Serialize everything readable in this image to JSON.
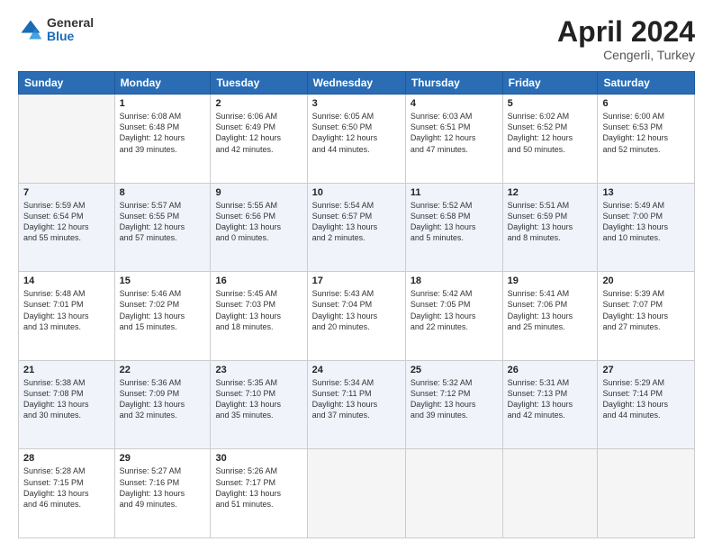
{
  "logo": {
    "general": "General",
    "blue": "Blue"
  },
  "title": {
    "month": "April 2024",
    "location": "Cengerli, Turkey"
  },
  "headers": [
    "Sunday",
    "Monday",
    "Tuesday",
    "Wednesday",
    "Thursday",
    "Friday",
    "Saturday"
  ],
  "weeks": [
    [
      {
        "date": "",
        "info": ""
      },
      {
        "date": "1",
        "info": "Sunrise: 6:08 AM\nSunset: 6:48 PM\nDaylight: 12 hours\nand 39 minutes."
      },
      {
        "date": "2",
        "info": "Sunrise: 6:06 AM\nSunset: 6:49 PM\nDaylight: 12 hours\nand 42 minutes."
      },
      {
        "date": "3",
        "info": "Sunrise: 6:05 AM\nSunset: 6:50 PM\nDaylight: 12 hours\nand 44 minutes."
      },
      {
        "date": "4",
        "info": "Sunrise: 6:03 AM\nSunset: 6:51 PM\nDaylight: 12 hours\nand 47 minutes."
      },
      {
        "date": "5",
        "info": "Sunrise: 6:02 AM\nSunset: 6:52 PM\nDaylight: 12 hours\nand 50 minutes."
      },
      {
        "date": "6",
        "info": "Sunrise: 6:00 AM\nSunset: 6:53 PM\nDaylight: 12 hours\nand 52 minutes."
      }
    ],
    [
      {
        "date": "7",
        "info": "Sunrise: 5:59 AM\nSunset: 6:54 PM\nDaylight: 12 hours\nand 55 minutes."
      },
      {
        "date": "8",
        "info": "Sunrise: 5:57 AM\nSunset: 6:55 PM\nDaylight: 12 hours\nand 57 minutes."
      },
      {
        "date": "9",
        "info": "Sunrise: 5:55 AM\nSunset: 6:56 PM\nDaylight: 13 hours\nand 0 minutes."
      },
      {
        "date": "10",
        "info": "Sunrise: 5:54 AM\nSunset: 6:57 PM\nDaylight: 13 hours\nand 2 minutes."
      },
      {
        "date": "11",
        "info": "Sunrise: 5:52 AM\nSunset: 6:58 PM\nDaylight: 13 hours\nand 5 minutes."
      },
      {
        "date": "12",
        "info": "Sunrise: 5:51 AM\nSunset: 6:59 PM\nDaylight: 13 hours\nand 8 minutes."
      },
      {
        "date": "13",
        "info": "Sunrise: 5:49 AM\nSunset: 7:00 PM\nDaylight: 13 hours\nand 10 minutes."
      }
    ],
    [
      {
        "date": "14",
        "info": "Sunrise: 5:48 AM\nSunset: 7:01 PM\nDaylight: 13 hours\nand 13 minutes."
      },
      {
        "date": "15",
        "info": "Sunrise: 5:46 AM\nSunset: 7:02 PM\nDaylight: 13 hours\nand 15 minutes."
      },
      {
        "date": "16",
        "info": "Sunrise: 5:45 AM\nSunset: 7:03 PM\nDaylight: 13 hours\nand 18 minutes."
      },
      {
        "date": "17",
        "info": "Sunrise: 5:43 AM\nSunset: 7:04 PM\nDaylight: 13 hours\nand 20 minutes."
      },
      {
        "date": "18",
        "info": "Sunrise: 5:42 AM\nSunset: 7:05 PM\nDaylight: 13 hours\nand 22 minutes."
      },
      {
        "date": "19",
        "info": "Sunrise: 5:41 AM\nSunset: 7:06 PM\nDaylight: 13 hours\nand 25 minutes."
      },
      {
        "date": "20",
        "info": "Sunrise: 5:39 AM\nSunset: 7:07 PM\nDaylight: 13 hours\nand 27 minutes."
      }
    ],
    [
      {
        "date": "21",
        "info": "Sunrise: 5:38 AM\nSunset: 7:08 PM\nDaylight: 13 hours\nand 30 minutes."
      },
      {
        "date": "22",
        "info": "Sunrise: 5:36 AM\nSunset: 7:09 PM\nDaylight: 13 hours\nand 32 minutes."
      },
      {
        "date": "23",
        "info": "Sunrise: 5:35 AM\nSunset: 7:10 PM\nDaylight: 13 hours\nand 35 minutes."
      },
      {
        "date": "24",
        "info": "Sunrise: 5:34 AM\nSunset: 7:11 PM\nDaylight: 13 hours\nand 37 minutes."
      },
      {
        "date": "25",
        "info": "Sunrise: 5:32 AM\nSunset: 7:12 PM\nDaylight: 13 hours\nand 39 minutes."
      },
      {
        "date": "26",
        "info": "Sunrise: 5:31 AM\nSunset: 7:13 PM\nDaylight: 13 hours\nand 42 minutes."
      },
      {
        "date": "27",
        "info": "Sunrise: 5:29 AM\nSunset: 7:14 PM\nDaylight: 13 hours\nand 44 minutes."
      }
    ],
    [
      {
        "date": "28",
        "info": "Sunrise: 5:28 AM\nSunset: 7:15 PM\nDaylight: 13 hours\nand 46 minutes."
      },
      {
        "date": "29",
        "info": "Sunrise: 5:27 AM\nSunset: 7:16 PM\nDaylight: 13 hours\nand 49 minutes."
      },
      {
        "date": "30",
        "info": "Sunrise: 5:26 AM\nSunset: 7:17 PM\nDaylight: 13 hours\nand 51 minutes."
      },
      {
        "date": "",
        "info": ""
      },
      {
        "date": "",
        "info": ""
      },
      {
        "date": "",
        "info": ""
      },
      {
        "date": "",
        "info": ""
      }
    ]
  ]
}
